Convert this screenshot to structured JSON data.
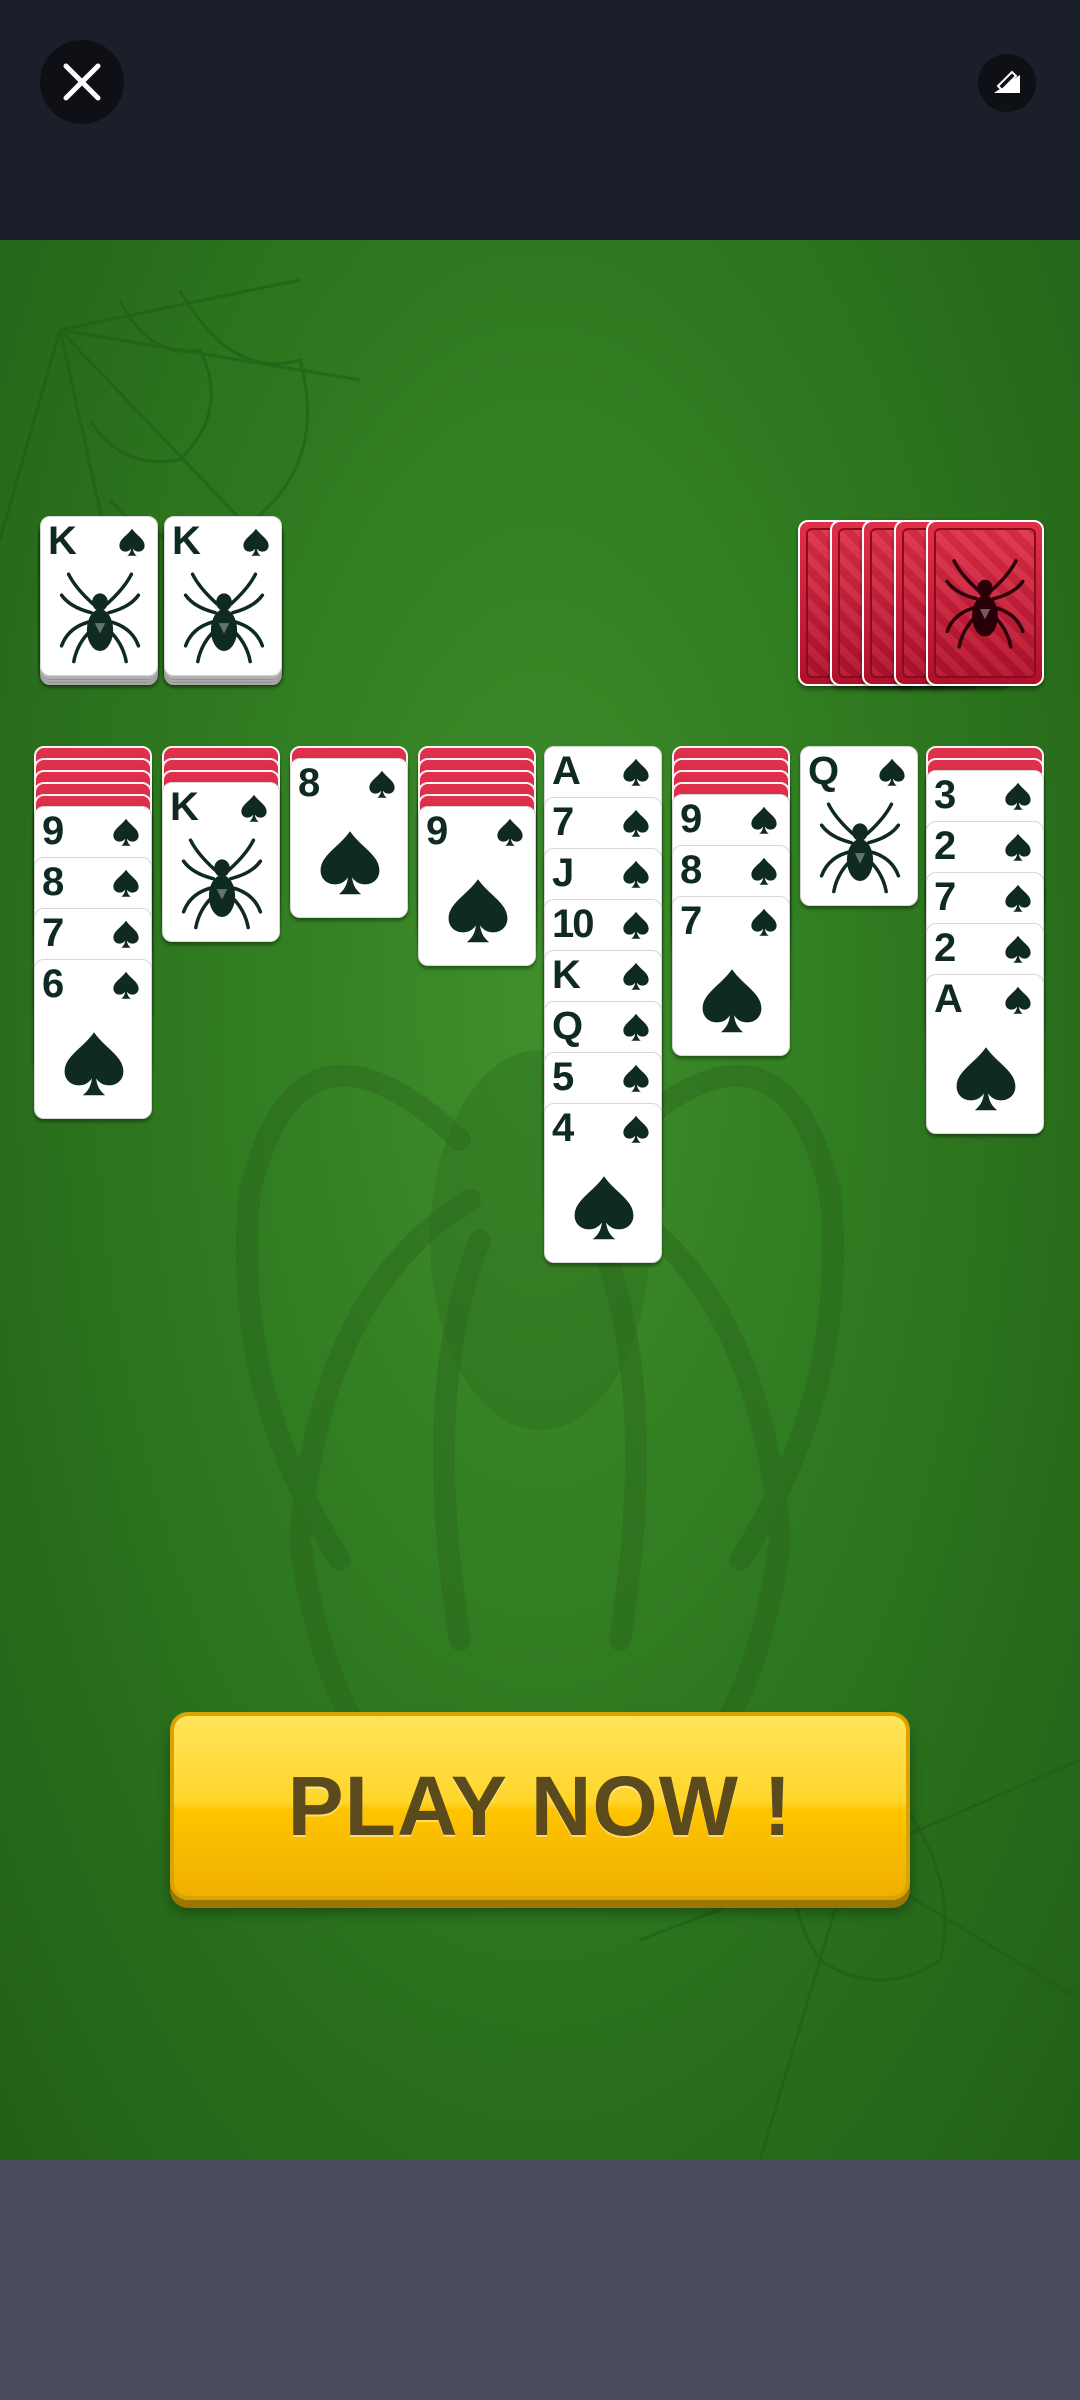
{
  "topbar": {
    "close_icon": "close-icon",
    "ad_icon": "ad-choices-icon"
  },
  "colors": {
    "felt": "#2f7a20",
    "card_back": "#c81a38",
    "button": "#ffc400",
    "button_text": "#5a4a1c"
  },
  "foundation": [
    {
      "rank": "K",
      "suit": "spade",
      "face": "spider"
    },
    {
      "rank": "K",
      "suit": "spade",
      "face": "spider"
    }
  ],
  "stock": {
    "piles": 5
  },
  "tableau": [
    {
      "hidden": 5,
      "cards": [
        "9",
        "8",
        "7",
        "6"
      ]
    },
    {
      "hidden": 3,
      "cards": [
        "K"
      ]
    },
    {
      "hidden": 1,
      "cards": [
        "8"
      ]
    },
    {
      "hidden": 5,
      "cards": [
        "9"
      ]
    },
    {
      "hidden": 0,
      "cards": [
        "A",
        "7",
        "J",
        "10",
        "K",
        "Q",
        "5",
        "4"
      ]
    },
    {
      "hidden": 4,
      "cards": [
        "9",
        "8",
        "7"
      ]
    },
    {
      "hidden": 0,
      "cards": [
        "Q"
      ]
    },
    {
      "hidden": 2,
      "cards": [
        "3",
        "2",
        "7",
        "2",
        "A"
      ]
    }
  ],
  "cta": {
    "label": "PLAY NOW !"
  }
}
